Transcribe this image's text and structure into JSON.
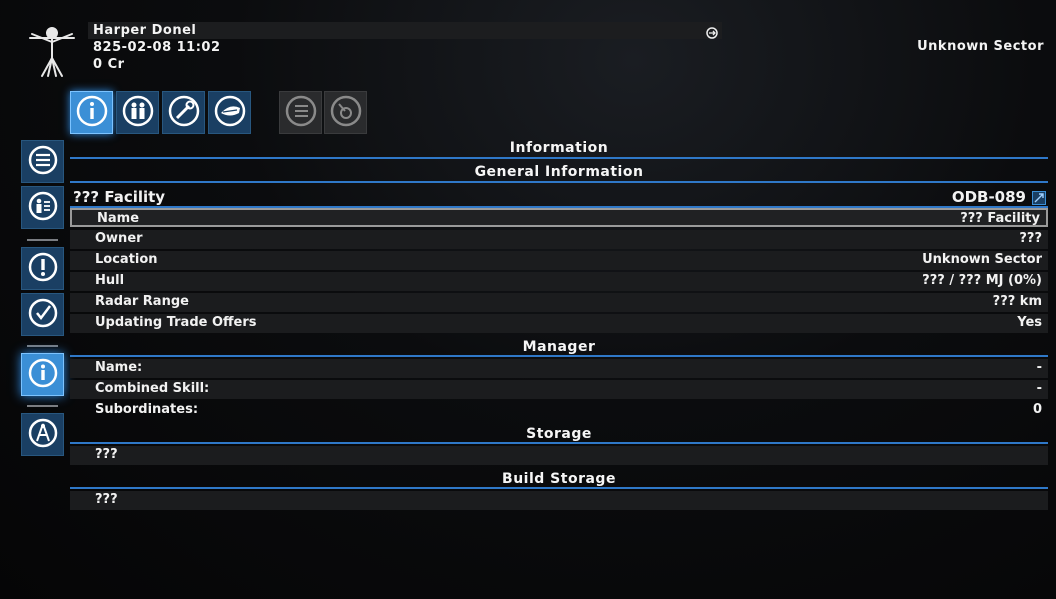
{
  "header": {
    "pilot_name": "Harper Donel",
    "datetime": "825-02-08 11:02",
    "credits": "0 Cr",
    "sector": "Unknown Sector"
  },
  "tabs": [
    {
      "icon": "info-icon",
      "state": "active"
    },
    {
      "icon": "crew-icon",
      "state": "normal"
    },
    {
      "icon": "wrench-icon",
      "state": "normal"
    },
    {
      "icon": "ship-icon",
      "state": "normal"
    },
    {
      "icon": "list-icon",
      "state": "disabled"
    },
    {
      "icon": "disc-icon",
      "state": "disabled"
    }
  ],
  "sidebar": [
    {
      "icon": "menu-icon"
    },
    {
      "icon": "people-list-icon"
    },
    {
      "icon": "alert-icon"
    },
    {
      "icon": "check-icon"
    },
    {
      "icon": "info-icon",
      "active": true
    },
    {
      "icon": "compass-icon"
    }
  ],
  "sections": {
    "information": "Information",
    "general": "General Information",
    "manager": "Manager",
    "storage": "Storage",
    "build_storage": "Build Storage"
  },
  "object": {
    "name": "??? Facility",
    "code": "ODB-089"
  },
  "general_rows": [
    {
      "key": "Name",
      "value": "??? Facility"
    },
    {
      "key": "Owner",
      "value": "???"
    },
    {
      "key": "Location",
      "value": "Unknown Sector"
    },
    {
      "key": "Hull",
      "value": "??? / ??? MJ (0%)"
    },
    {
      "key": "Radar Range",
      "value": "??? km"
    },
    {
      "key": "Updating Trade Offers",
      "value": "Yes"
    }
  ],
  "manager_rows": [
    {
      "key": "Name:",
      "value": "-"
    },
    {
      "key": "Combined Skill:",
      "value": "-"
    },
    {
      "key": "Subordinates:",
      "value": "0"
    }
  ],
  "storage_value": "???",
  "build_storage_value": "???",
  "colors": {
    "accent": "#2f78c8",
    "active_button": "#3b8fd6",
    "button": "#1a3f63"
  }
}
